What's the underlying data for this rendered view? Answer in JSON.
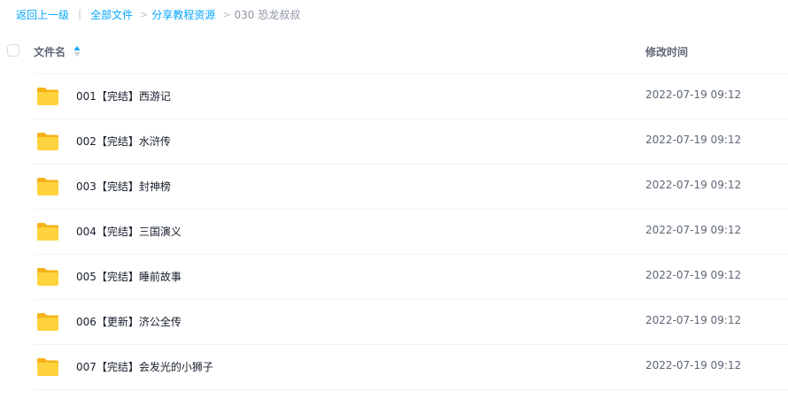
{
  "breadcrumb": {
    "back_label": "返回上一级",
    "separator": "|",
    "items": [
      {
        "label": "全部文件"
      },
      {
        "label": "分享教程资源"
      }
    ],
    "current": "030 恐龙叔叔"
  },
  "header": {
    "name_label": "文件名",
    "time_label": "修改时间"
  },
  "files": [
    {
      "name": "001【完结】西游记",
      "modified": "2022-07-19 09:12"
    },
    {
      "name": "002【完结】水浒传",
      "modified": "2022-07-19 09:12"
    },
    {
      "name": "003【完结】封神榜",
      "modified": "2022-07-19 09:12"
    },
    {
      "name": "004【完结】三国演义",
      "modified": "2022-07-19 09:12"
    },
    {
      "name": "005【完结】睡前故事",
      "modified": "2022-07-19 09:12"
    },
    {
      "name": "006【更新】济公全传",
      "modified": "2022-07-19 09:12"
    },
    {
      "name": "007【完结】会发光的小狮子",
      "modified": "2022-07-19 09:12"
    }
  ],
  "colors": {
    "accent": "#06a7ff",
    "folder_front": "#ffd33d",
    "folder_back": "#f5b317"
  },
  "icons": {
    "folder": "folder-icon",
    "sort": "sort-icon",
    "chevron": "chevron-right-icon"
  }
}
